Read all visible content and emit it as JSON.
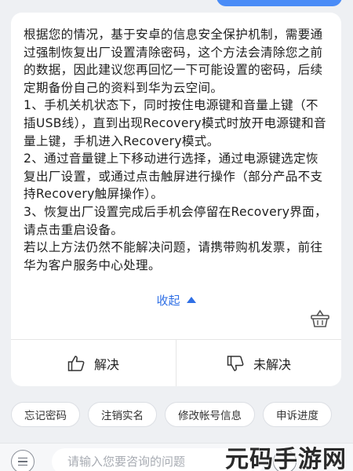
{
  "answer": {
    "paragraphs": [
      "根据您的情况，基于安卓的信息安全保护机制，需要通过强制恢复出厂设置清除密码，这个方法会清除您之前的数据，因此建议您再回忆一下可能设置的密码，后续定期备份自己的资料到华为云空间。",
      "1、手机关机状态下，同时按住电源键和音量上键（不插USB线），直到出现Recovery模式时放开电源键和音量上键，手机进入Recovery模式。",
      "2、通过音量键上下移动进行选择，通过电源键选定恢复出厂设置，或通过点击触屏进行操作（部分产品不支持Recovery触屏操作）。",
      "3、恢复出厂设置完成后手机会停留在Recovery界面，请点击重启设备。",
      "若以上方法仍然不能解决问题，请携带购机发票，前往华为客户服务中心处理。"
    ],
    "collapse_label": "收起"
  },
  "feedback": {
    "solved_label": "解决",
    "unsolved_label": "未解决"
  },
  "suggestions": [
    "忘记密码",
    "注销实名",
    "修改帐号信息",
    "申诉进度"
  ],
  "input": {
    "placeholder": "请输入您要咨询的问题"
  },
  "watermark": "元码手游网",
  "colors": {
    "accent": "#2f6fe5",
    "background": "#eef0f3",
    "card": "#ffffff"
  }
}
